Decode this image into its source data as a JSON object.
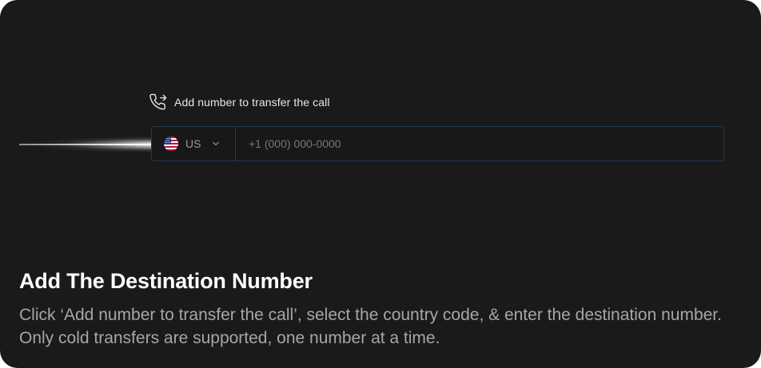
{
  "transfer": {
    "label": "Add number to transfer the call",
    "icon": "phone-forward-icon"
  },
  "phone_input": {
    "country_code": "US",
    "flag_icon": "us-flag-icon",
    "dropdown_icon": "chevron-down-icon",
    "placeholder": "+1 (000) 000-0000",
    "value": ""
  },
  "caption": {
    "title": "Add The Destination Number",
    "description": "Click ‘Add number to transfer the call’, select the country code, & enter the destination number. Only cold transfers are supported, one number at a time."
  },
  "colors": {
    "background": "#1a1a1a",
    "input_border": "#1f3a52",
    "title": "#ffffff",
    "description": "#a6a6a6"
  }
}
